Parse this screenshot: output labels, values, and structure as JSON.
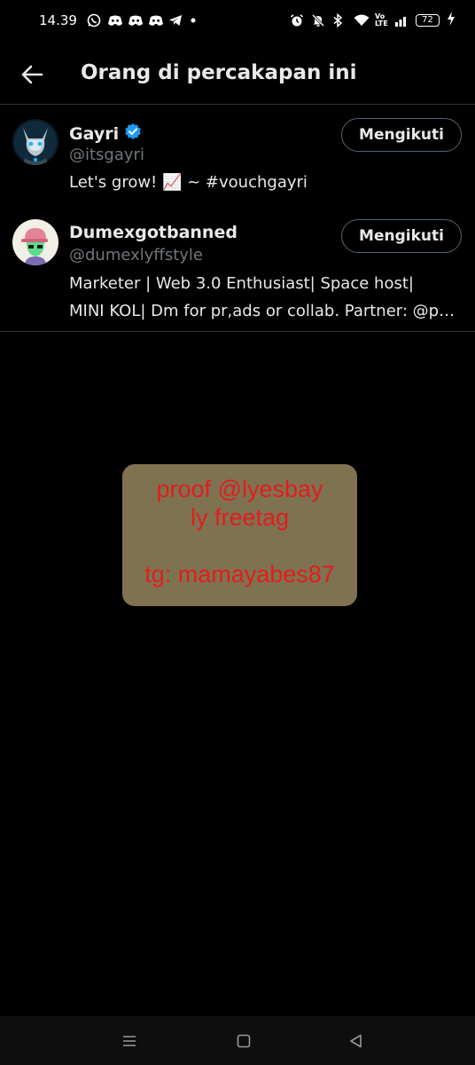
{
  "status_bar": {
    "time": "14.39",
    "left_icons": [
      "whatsapp-icon",
      "discord-icon",
      "discord-icon",
      "discord-icon",
      "telegram-icon",
      "dot-icon"
    ],
    "right_icons": [
      "alarm-icon",
      "mute-icon",
      "bluetooth-icon",
      "wifi-icon",
      "volte-icon",
      "signal-icon",
      "battery-icon",
      "charging-icon"
    ],
    "volte_label": "Vo LTE",
    "battery_level": "72"
  },
  "header": {
    "title": "Orang di percakapan ini",
    "back_icon": "arrow-left-icon"
  },
  "users": [
    {
      "name": "Gayri",
      "verified": true,
      "handle": "@itsgayri",
      "bio_lines": [
        "Let's grow! 📈 ~ #vouchgayri"
      ],
      "follow_label": "Mengikuti"
    },
    {
      "name": "Dumexgotbanned",
      "verified": false,
      "handle": "@dumexlyffstyle",
      "bio_lines": [
        "Marketer | Web 3.0 Enthusiast| Space host|",
        "MINI KOL| Dm for pr,ads or collab. Partner: @p…"
      ],
      "follow_label": "Mengikuti"
    }
  ],
  "watermark": {
    "line1": "proof @lyesbay",
    "line2": "ly freetag",
    "line3": "tg: mamayabes87"
  },
  "nav_bar": {
    "icons": [
      "recents-icon",
      "home-icon",
      "back-icon"
    ]
  },
  "colors": {
    "background": "#000000",
    "text_primary": "#e7e9ea",
    "text_secondary": "#71767b",
    "divider": "#2f3336",
    "verified_blue": "#1d9bf0",
    "watermark_bg": "#7f7250",
    "watermark_text": "#e11d1d"
  }
}
